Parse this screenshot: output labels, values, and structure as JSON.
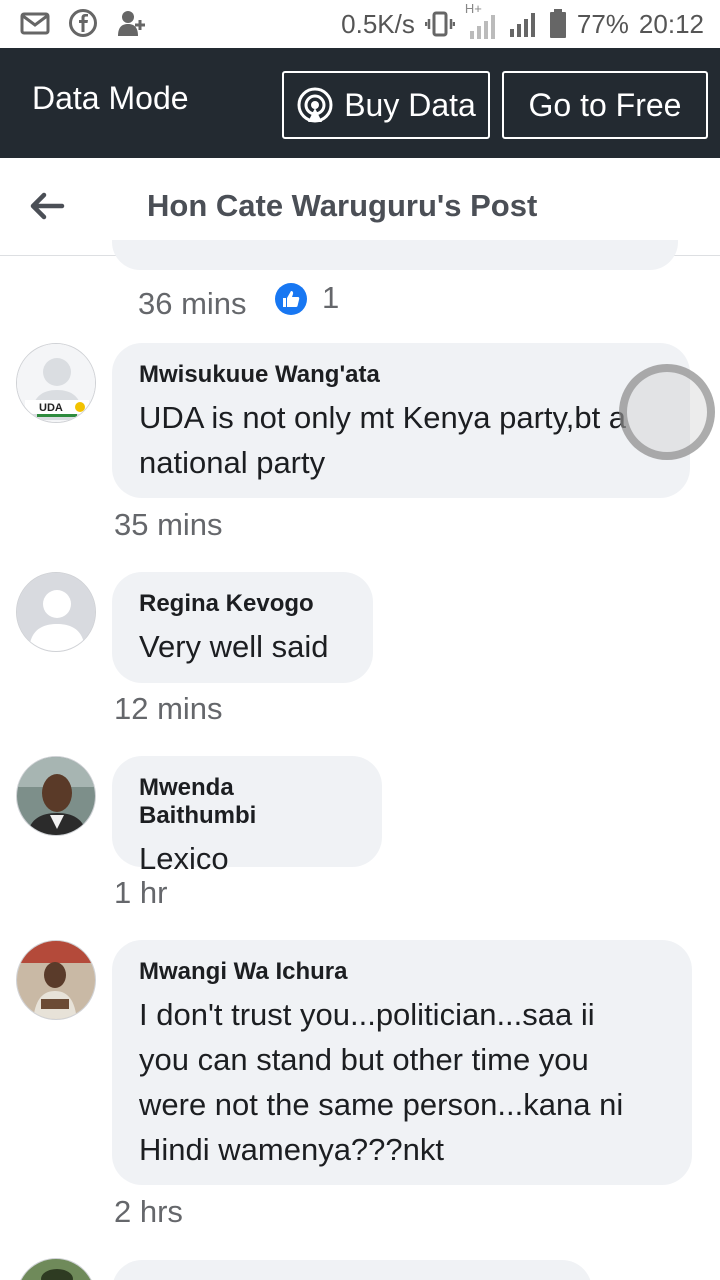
{
  "status_bar": {
    "net_speed": "0.5K/s",
    "network": "H+",
    "battery": "77%",
    "time": "20:12"
  },
  "data_mode": {
    "title": "Data Mode",
    "buy_label": "Buy Data",
    "free_label": "Go to Free"
  },
  "header": {
    "title": "Hon Cate Waruguru's Post"
  },
  "previous_comment": {
    "time": "36 mins",
    "likes": "1"
  },
  "comments": [
    {
      "author": "Mwisukuue Wang'ata",
      "text_lines": [
        "UDA is not only mt Kenya party,bt a",
        "national party"
      ],
      "time": "35 mins",
      "avatar": "uda-default-avatar"
    },
    {
      "author": "Regina Kevogo",
      "text_lines": [
        "Very well said"
      ],
      "time": "12 mins",
      "avatar": "default-avatar"
    },
    {
      "author": "Mwenda Baithumbi",
      "text_lines": [
        "Lexico"
      ],
      "time": "1 hr",
      "avatar": "photo-avatar"
    },
    {
      "author": "Mwangi Wa Ichura",
      "text_lines": [
        "I don't trust you...politician...saa ii",
        "you can stand but other time you",
        "were not the same person...kana ni",
        "Hindi wamenya???nkt"
      ],
      "time": "2 hrs",
      "avatar": "photo-avatar"
    }
  ],
  "colors": {
    "data_bar": "#232a31",
    "bubble": "#f0f2f5",
    "like_blue": "#1877f2",
    "meta_text": "#65676b"
  }
}
